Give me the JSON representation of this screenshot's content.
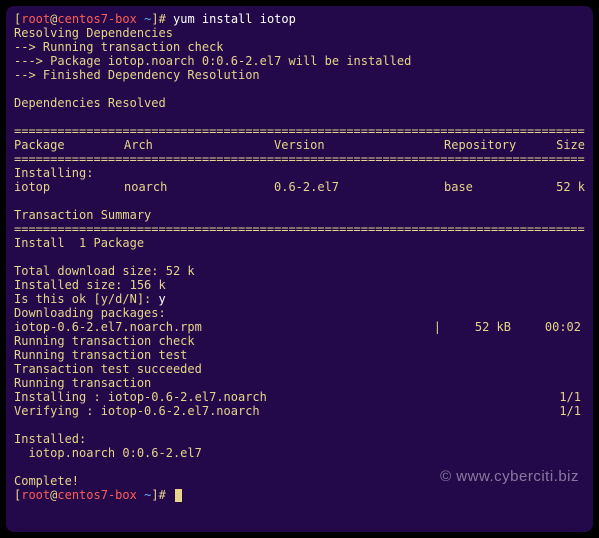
{
  "prompt": {
    "user": "root",
    "host": "centos7-box",
    "path": "~",
    "symbol": "#",
    "command": "yum install iotop"
  },
  "lines": {
    "resolving": "Resolving Dependencies",
    "trans_check": "--> Running transaction check",
    "pkg_will_install": "---> Package iotop.noarch 0:0.6-2.el7 will be installed",
    "finished_dep": "--> Finished Dependency Resolution",
    "deps_resolved": "Dependencies Resolved",
    "installing_hdr": "Installing:",
    "trans_summary": "Transaction Summary",
    "install_count": "Install  1 Package",
    "total_dl": "Total download size: 52 k",
    "installed_size": "Installed size: 156 k",
    "confirm_q": "Is this ok [y/d/N]: ",
    "confirm_a": "y",
    "downloading": "Downloading packages:",
    "run_trans_check": "Running transaction check",
    "run_trans_test": "Running transaction test",
    "trans_test_ok": "Transaction test succeeded",
    "run_trans": "Running transaction",
    "installing_step": "  Installing : iotop-0.6-2.el7.noarch",
    "verifying_step": "  Verifying  : iotop-0.6-2.el7.noarch",
    "progress": "1/1",
    "installed_hdr": "Installed:",
    "installed_pkg": "  iotop.noarch 0:0.6-2.el7",
    "complete": "Complete!"
  },
  "headers": {
    "package": " Package",
    "arch": "Arch",
    "version": "Version",
    "repository": "Repository",
    "size": "Size"
  },
  "package_row": {
    "name": " iotop",
    "arch": "noarch",
    "version": "0.6-2.el7",
    "repository": "base",
    "size": "52 k"
  },
  "download": {
    "file": "iotop-0.6-2.el7.noarch.rpm",
    "bar": "|",
    "size": "52 kB",
    "time": "00:02"
  },
  "separator_double": "================================================================================",
  "separator_equals": "================================================================================",
  "watermark": "© www.cyberciti.biz"
}
